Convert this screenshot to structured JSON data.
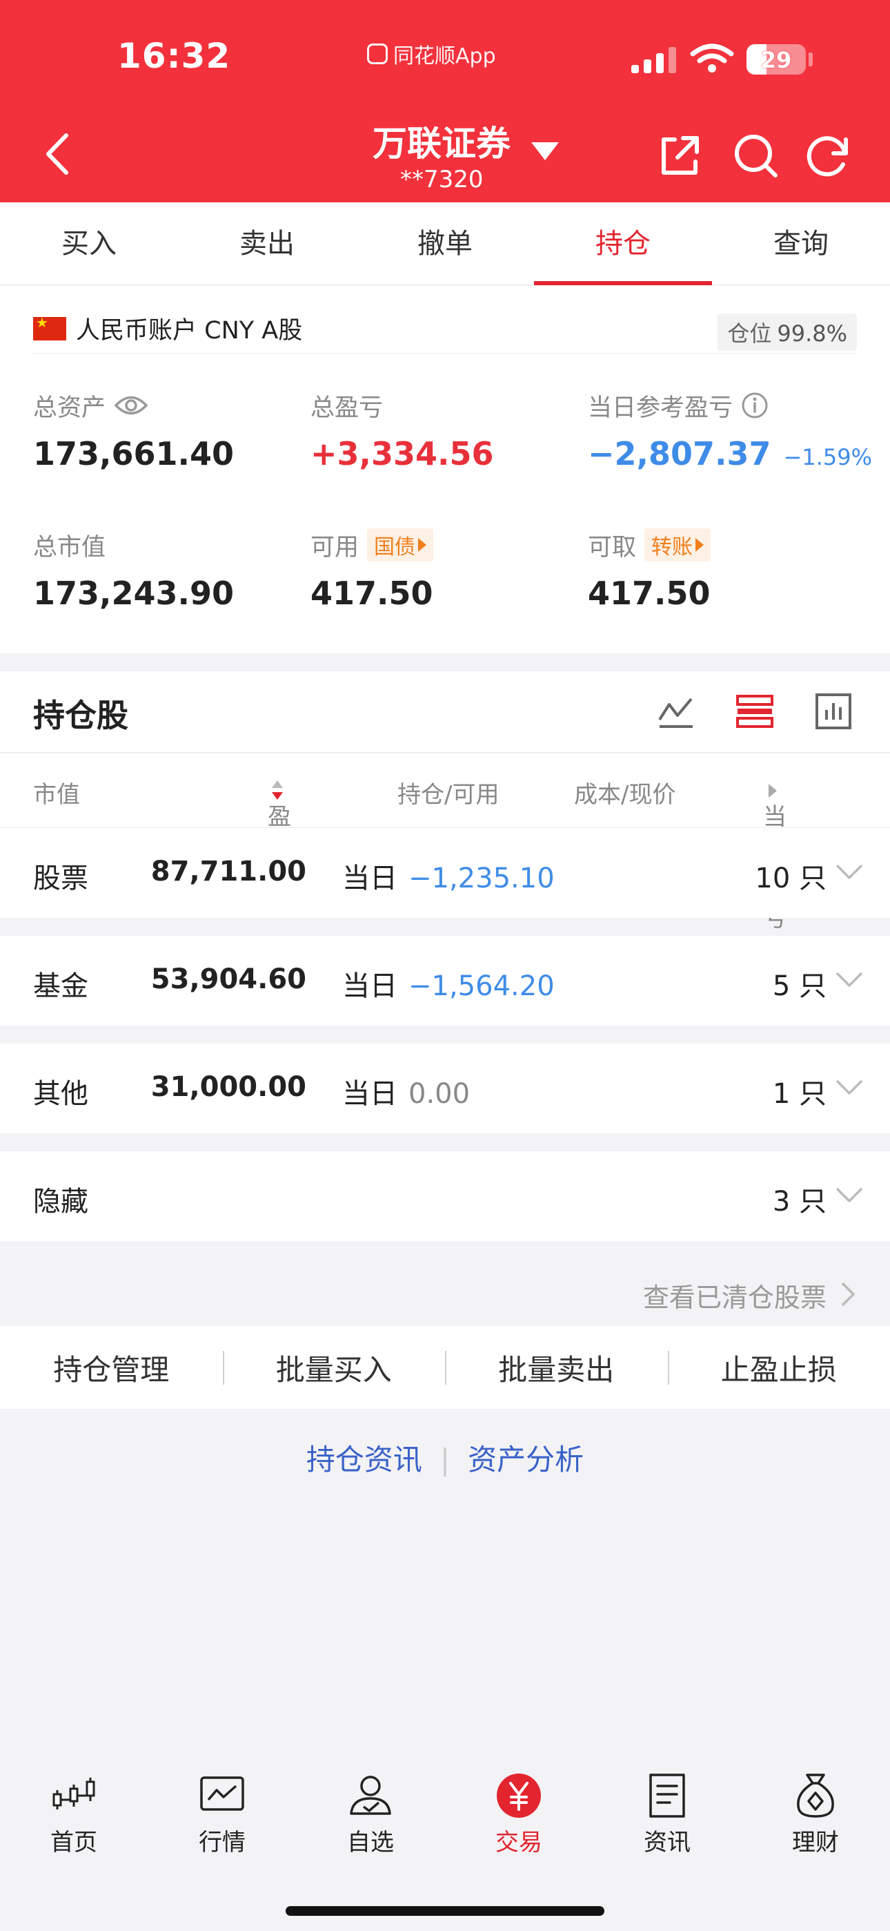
{
  "status": {
    "time": "16:32",
    "app_name": "同花顺App",
    "battery": "29"
  },
  "header": {
    "title": "万联证券",
    "account_masked": "**7320"
  },
  "tabs": [
    {
      "label": "买入"
    },
    {
      "label": "卖出"
    },
    {
      "label": "撤单"
    },
    {
      "label": "持仓",
      "active": true
    },
    {
      "label": "查询"
    }
  ],
  "account": {
    "label": "人民币账户 CNY A股",
    "position_label": "仓位",
    "position_value": "99.8%"
  },
  "metrics": {
    "total_assets_label": "总资产",
    "total_assets": "173,661.40",
    "total_pnl_label": "总盈亏",
    "total_pnl": "+3,334.56",
    "day_pnl_label": "当日参考盈亏",
    "day_pnl": "−2,807.37",
    "day_pnl_pct": "−1.59%",
    "market_value_label": "总市值",
    "market_value": "173,243.90",
    "available_label": "可用",
    "available_tag": "国债",
    "available": "417.50",
    "withdrawable_label": "可取",
    "withdrawable_tag": "转账",
    "withdrawable": "417.50"
  },
  "holdings": {
    "title": "持仓股",
    "columns": {
      "market_value": "市值",
      "pnl": "盈亏",
      "position": "持仓/可用",
      "cost": "成本/现价",
      "day_pnl": "当日盈亏"
    },
    "groups": [
      {
        "name": "股票",
        "value": "87,711.00",
        "day_label": "当日",
        "day_change": "−1,235.10",
        "count": "10 只",
        "trend": "down"
      },
      {
        "name": "基金",
        "value": "53,904.60",
        "day_label": "当日",
        "day_change": "−1,564.20",
        "count": "5 只",
        "trend": "down"
      },
      {
        "name": "其他",
        "value": "31,000.00",
        "day_label": "当日",
        "day_change": "0.00",
        "count": "1 只",
        "trend": "flat"
      },
      {
        "name": "隐藏",
        "count": "3 只"
      }
    ],
    "cleared_link": "查看已清仓股票"
  },
  "actions": [
    "持仓管理",
    "批量买入",
    "批量卖出",
    "止盈止损"
  ],
  "links": [
    "持仓资讯",
    "资产分析"
  ],
  "nav": [
    {
      "label": "首页",
      "icon": "candlestick-icon"
    },
    {
      "label": "行情",
      "icon": "chart-icon"
    },
    {
      "label": "自选",
      "icon": "user-check-icon"
    },
    {
      "label": "交易",
      "icon": "yen-icon",
      "active": true
    },
    {
      "label": "资讯",
      "icon": "document-icon"
    },
    {
      "label": "理财",
      "icon": "money-bag-icon"
    }
  ],
  "colors": {
    "brand_red": "#f2313c",
    "up": "#e8303a",
    "down": "#3f8ce8",
    "tag_orange": "#f07f1c",
    "link_blue": "#3a62c8"
  }
}
